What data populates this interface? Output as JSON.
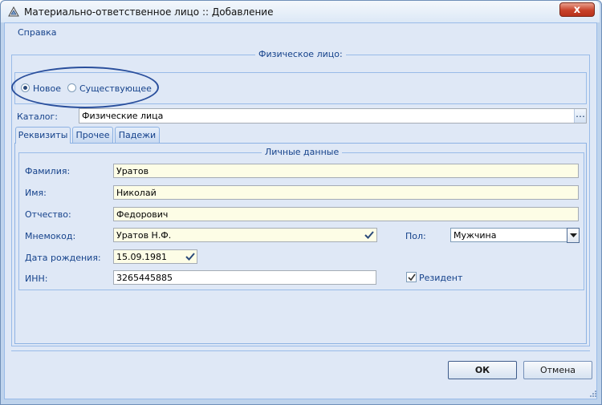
{
  "window": {
    "title": "Материально-ответственное лицо :: Добавление",
    "close_glyph": "x"
  },
  "menu": {
    "help": "Справка"
  },
  "person": {
    "legend": "Физическое лицо:",
    "radio_new": "Новое",
    "radio_existing": "Существующее",
    "catalog_label": "Каталог:",
    "catalog_value": "Физические лица",
    "catalog_trigger": "…"
  },
  "tabs": [
    {
      "label": "Реквизиты"
    },
    {
      "label": "Прочее"
    },
    {
      "label": "Падежи"
    }
  ],
  "personal": {
    "legend": "Личные данные",
    "surname_label": "Фамилия:",
    "surname_value": "Уратов",
    "name_label": "Имя:",
    "name_value": "Николай",
    "patronymic_label": "Отчество:",
    "patronymic_value": "Федорович",
    "mnemo_label": "Мнемокод:",
    "mnemo_value": "Уратов Н.Ф.",
    "gender_label": "Пол:",
    "gender_value": "Мужчина",
    "birth_label": "Дата рождения:",
    "birth_value": "15.09.1981",
    "inn_label": "ИНН:",
    "inn_value": "3265445885",
    "resident_label": "Резидент"
  },
  "buttons": {
    "ok": "ОК",
    "cancel": "Отмена"
  },
  "colors": {
    "accent": "#15428b",
    "annotation": "#2a4f9c"
  }
}
